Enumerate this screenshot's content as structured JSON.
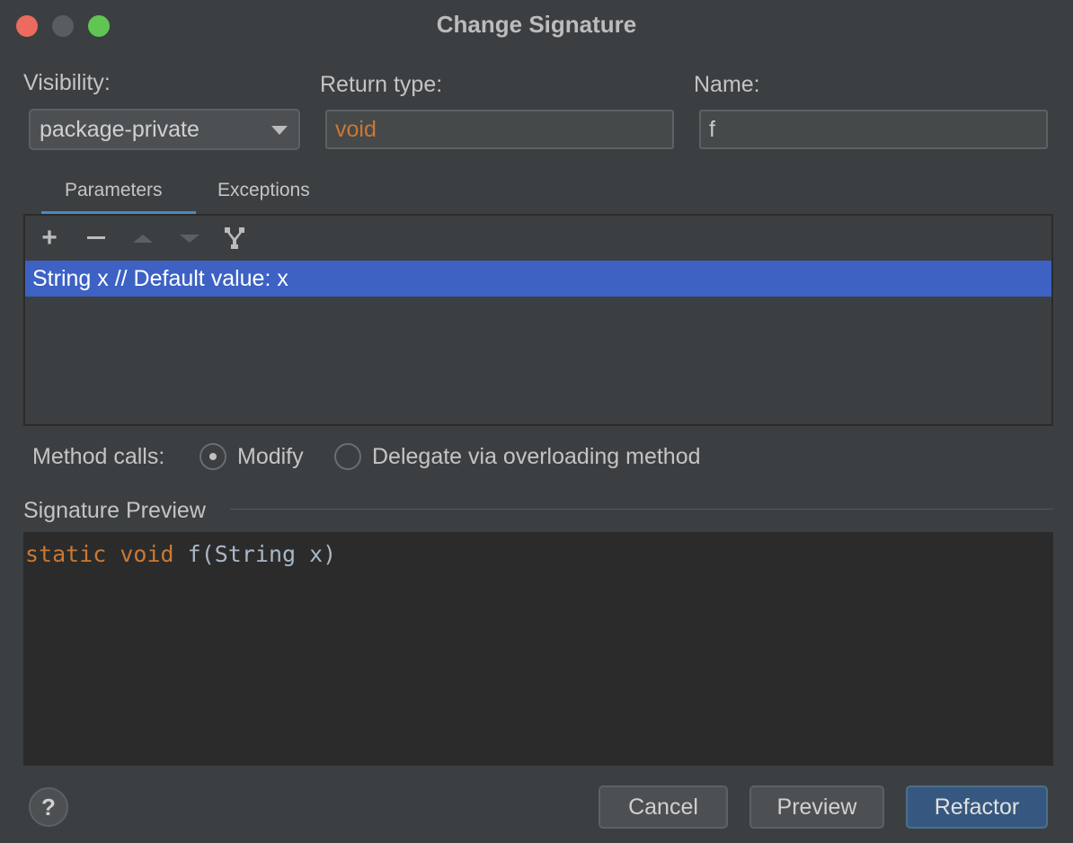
{
  "window": {
    "title": "Change Signature"
  },
  "visibility": {
    "label": "Visibility:",
    "value": "package-private"
  },
  "return_type": {
    "label": "Return type:",
    "value": "void"
  },
  "name": {
    "label": "Name:",
    "value": "f"
  },
  "tabs": [
    {
      "label": "Parameters",
      "active": true
    },
    {
      "label": "Exceptions",
      "active": false
    }
  ],
  "toolbar": {
    "icons": [
      "plus-icon",
      "minus-icon",
      "move-up-icon",
      "move-down-icon",
      "propagate-icon"
    ]
  },
  "parameters": [
    {
      "text": "String x // Default value: x",
      "selected": true
    }
  ],
  "method_calls": {
    "label": "Method calls:",
    "options": [
      {
        "label": "Modify",
        "selected": true
      },
      {
        "label": "Delegate via overloading method",
        "selected": false
      }
    ]
  },
  "signature_preview": {
    "label": "Signature Preview",
    "kw1": "static",
    "kw2": "void",
    "rest": "f(String x)"
  },
  "buttons": {
    "help": "?",
    "cancel": "Cancel",
    "preview": "Preview",
    "refactor": "Refactor"
  },
  "colors": {
    "accent": "#3d62c4",
    "keyword": "#cc7832",
    "default_button": "#365880"
  }
}
